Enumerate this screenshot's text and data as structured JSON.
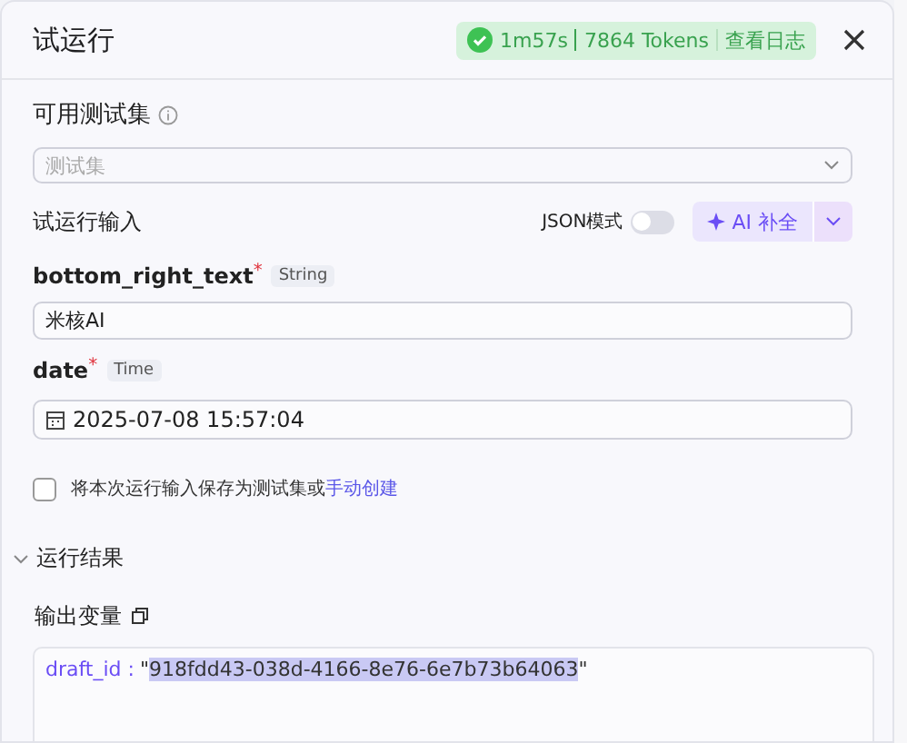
{
  "title": "试运行",
  "status": {
    "success": true,
    "duration": "1m57s",
    "tokens": "7864 Tokens",
    "log_link": "查看日志"
  },
  "test_set": {
    "label": "可用测试集",
    "placeholder": "测试集"
  },
  "run_input": {
    "label": "试运行输入",
    "json_mode": {
      "label": "JSON模式",
      "on": false
    },
    "ai_button": "AI 补全"
  },
  "fields": [
    {
      "name": "bottom_right_text",
      "required_mark": "*",
      "type": "String",
      "kind": "text",
      "value": "米核AI"
    },
    {
      "name": "date",
      "required_mark": "*",
      "type": "Time",
      "kind": "date",
      "value": "2025-07-08 15:57:04"
    }
  ],
  "save_option": {
    "checked": false,
    "text": "将本次运行输入保存为测试集或",
    "link": "手动创建"
  },
  "results": {
    "title": "运行结果",
    "expanded": true,
    "output_label": "输出变量",
    "output": {
      "key": "draft_id :",
      "open_quote": "\"",
      "close_quote": "\"",
      "value": "918fdd43-038d-4166-8e76-6e7b73b64063",
      "highlighted": true
    }
  }
}
